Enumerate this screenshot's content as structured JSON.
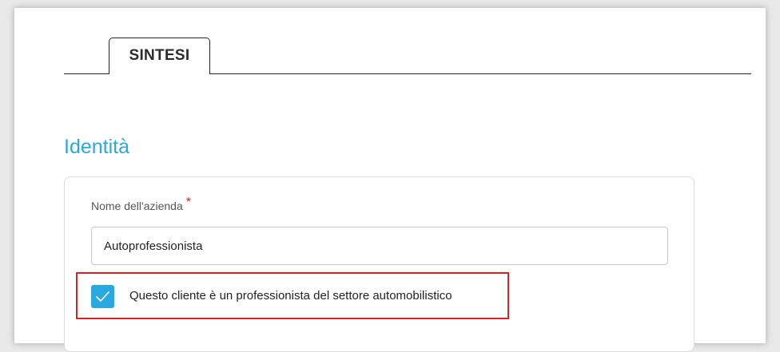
{
  "tabs": [
    {
      "label": "SINTESI",
      "active": true
    }
  ],
  "section": {
    "title": "Identità"
  },
  "form": {
    "company_name": {
      "label": "Nome dell'azienda",
      "required_marker": "*",
      "value": "Autoprofessionista"
    },
    "auto_professional": {
      "label": "Questo cliente è un professionista del settore automobilistico",
      "checked": true
    }
  },
  "colors": {
    "accent": "#2aa8e0",
    "required": "#e02020",
    "highlight": "#e02020"
  },
  "icons": {
    "checkbox": "checkmark-icon"
  }
}
